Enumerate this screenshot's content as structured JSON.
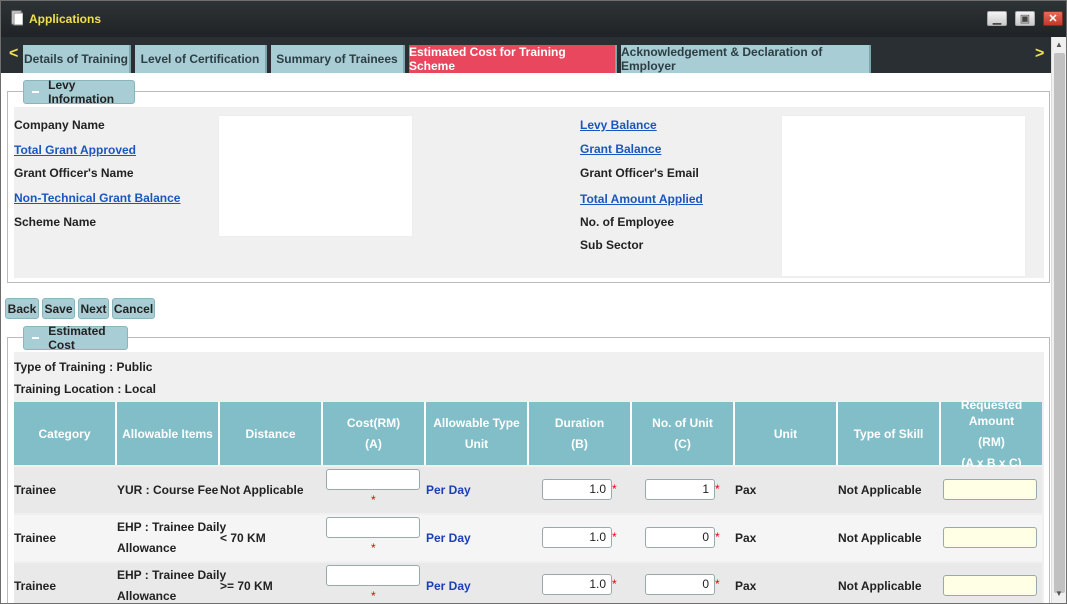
{
  "window": {
    "title": "Applications",
    "minimize_icon": "minimize-icon",
    "restore_icon": "restore-icon",
    "close_icon": "close-icon"
  },
  "tabs": [
    {
      "label": "Details of Training"
    },
    {
      "label": "Level of Certification"
    },
    {
      "label": "Summary of Trainees"
    },
    {
      "label": "Estimated Cost for Training Scheme",
      "active": true
    },
    {
      "label": "Acknowledgement & Declaration of Employer"
    }
  ],
  "levy": {
    "legend": "Levy Information",
    "left": [
      "Company Name",
      "Total Grant Approved",
      "Grant Officer's Name",
      "Non-Technical Grant Balance",
      "Scheme Name"
    ],
    "right": [
      "Levy Balance",
      "Grant Balance",
      "Grant Officer's Email",
      "Total Amount Applied",
      "No. of Employee",
      "Sub Sector"
    ]
  },
  "actions": {
    "back": "Back",
    "save": "Save",
    "next": "Next",
    "cancel": "Cancel"
  },
  "estimated": {
    "legend": "Estimated Cost",
    "type_of_training": "Type of Training : Public",
    "training_location": "Training Location : Local",
    "headers": {
      "category": "Category",
      "allowable_items": "Allowable Items",
      "distance": "Distance",
      "cost_line1": "Cost(RM)",
      "cost_line2": "(A)",
      "type_unit_line1": "Allowable Type",
      "type_unit_line2": "Unit",
      "duration_line1": "Duration",
      "duration_line2": "(B)",
      "units_line1": "No. of Unit",
      "units_line2": "(C)",
      "unit": "Unit",
      "skill": "Type of Skill",
      "req_line1": "Requested Amount",
      "req_line2": "(RM)",
      "req_line3": "(A x B x C)"
    },
    "rows": [
      {
        "category": "Trainee",
        "item1": "YUR : Course Fee",
        "item2": "",
        "distance": "Not Applicable",
        "type_unit": "Per Day",
        "duration": "1.0",
        "units": "1",
        "unit": "Pax",
        "skill": "Not Applicable"
      },
      {
        "category": "Trainee",
        "item1": "EHP : Trainee Daily",
        "item2": "Allowance",
        "distance": "< 70 KM",
        "type_unit": "Per Day",
        "duration": "1.0",
        "units": "0",
        "unit": "Pax",
        "skill": "Not Applicable"
      },
      {
        "category": "Trainee",
        "item1": "EHP : Trainee Daily",
        "item2": "Allowance",
        "distance": ">= 70 KM",
        "type_unit": "Per Day",
        "duration": "1.0",
        "units": "0",
        "unit": "Pax",
        "skill": "Not Applicable"
      }
    ],
    "required_mark": "*"
  }
}
